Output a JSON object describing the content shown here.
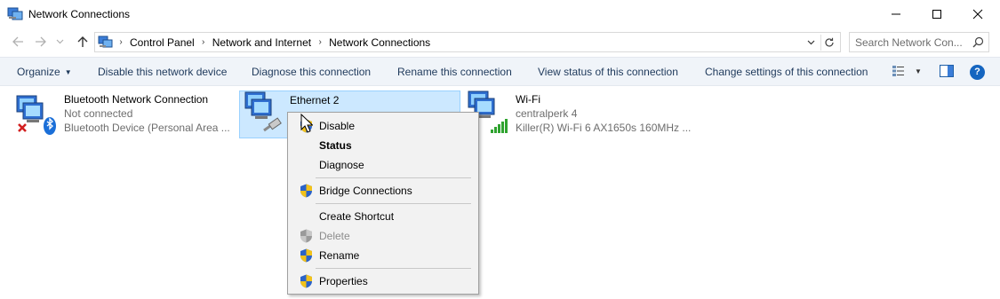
{
  "window": {
    "title": "Network Connections",
    "controls": {
      "minimize": "minimize",
      "maximize": "maximize",
      "close": "close"
    }
  },
  "address": {
    "crumbs": [
      "Control Panel",
      "Network and Internet",
      "Network Connections"
    ],
    "search_placeholder": "Search Network Con..."
  },
  "commands": {
    "organize": "Organize",
    "disable": "Disable this network device",
    "diagnose": "Diagnose this connection",
    "rename": "Rename this connection",
    "view_status": "View status of this connection",
    "change_settings": "Change settings of this connection",
    "help": "?"
  },
  "connections": [
    {
      "name": "Bluetooth Network Connection",
      "status": "Not connected",
      "device": "Bluetooth Device (Personal Area ..."
    },
    {
      "name": "Ethernet 2",
      "status": "",
      "device": ""
    },
    {
      "name": "Wi-Fi",
      "status": "centralperk 4",
      "device": "Killer(R) Wi-Fi 6 AX1650s 160MHz ..."
    }
  ],
  "context_menu": {
    "items": [
      {
        "label": "Disable",
        "shield": true,
        "bold": false,
        "disabled": false
      },
      {
        "label": "Status",
        "shield": false,
        "bold": true,
        "disabled": false
      },
      {
        "label": "Diagnose",
        "shield": false,
        "bold": false,
        "disabled": false
      },
      {
        "label": "Bridge Connections",
        "shield": true,
        "bold": false,
        "disabled": false
      },
      {
        "label": "Create Shortcut",
        "shield": false,
        "bold": false,
        "disabled": false
      },
      {
        "label": "Delete",
        "shield": true,
        "bold": false,
        "disabled": true
      },
      {
        "label": "Rename",
        "shield": true,
        "bold": false,
        "disabled": false
      },
      {
        "label": "Properties",
        "shield": true,
        "bold": false,
        "disabled": false
      }
    ]
  },
  "colors": {
    "accent": "#1e395b",
    "selection_bg": "#cce8ff",
    "selection_border": "#99d1ff",
    "help_blue": "#1565c0"
  }
}
